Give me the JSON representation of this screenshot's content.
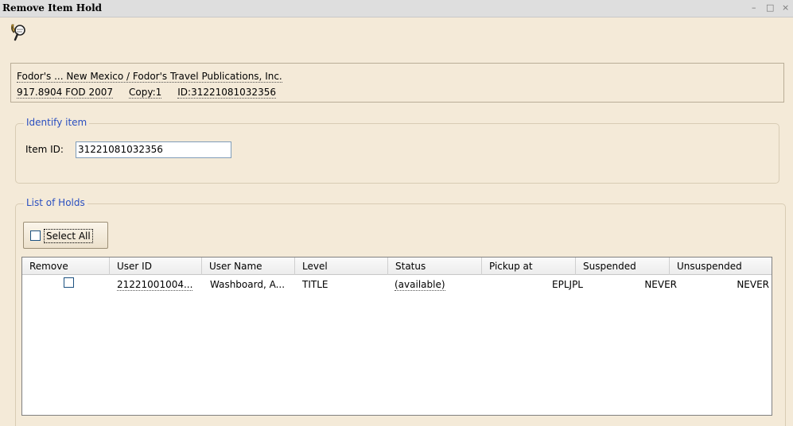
{
  "window": {
    "title": "Remove Item Hold",
    "controls": {
      "minimize": "–",
      "maximize": "□",
      "close": "×"
    }
  },
  "toolbar": {
    "icon": "magnifier-icon"
  },
  "item_info": {
    "title_author": "Fodor's ... New Mexico / Fodor's Travel Publications, Inc.",
    "call_number": "917.8904 FOD 2007",
    "copy": "Copy:1",
    "id": "ID:31221081032356"
  },
  "identify": {
    "legend": "Identify item",
    "label": "Item ID:",
    "value": "31221081032356"
  },
  "holds": {
    "legend": "List of Holds",
    "select_all_label": "Select All",
    "columns": [
      "Remove",
      "User ID",
      "User Name",
      "Level",
      "Status",
      "Pickup at",
      "Suspended",
      "Unsuspended"
    ],
    "rows": [
      {
        "user_id": "21221001004...",
        "user_name": "Washboard, A...",
        "level": "TITLE",
        "status": "(available)",
        "pickup_at": "EPLJPL",
        "suspended": "NEVER",
        "unsuspended": "NEVER"
      }
    ]
  }
}
